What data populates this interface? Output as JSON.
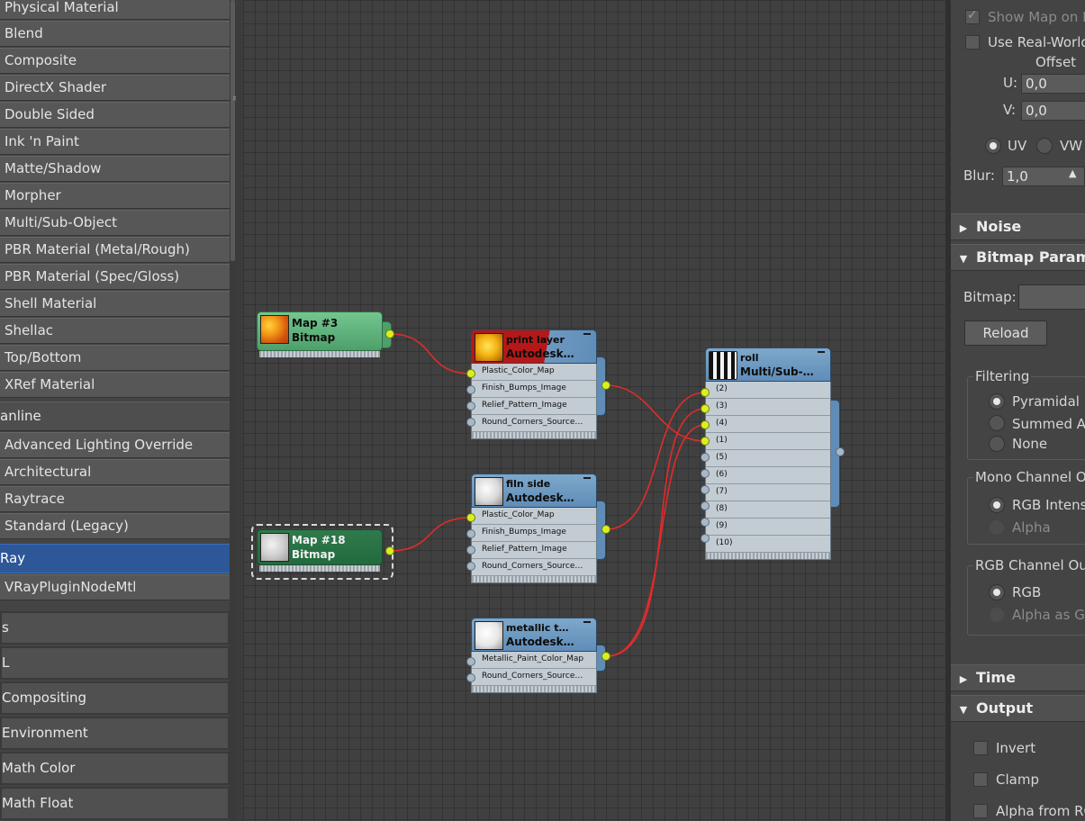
{
  "left_panel": {
    "materials": [
      "Physical Material",
      "Blend",
      "Composite",
      "DirectX Shader",
      "Double Sided",
      "Ink 'n Paint",
      "Matte/Shadow",
      "Morpher",
      "Multi/Sub-Object",
      "PBR Material (Metal/Rough)",
      "PBR Material (Spec/Gloss)",
      "Shell Material",
      "Shellac",
      "Top/Bottom",
      "XRef Material"
    ],
    "scanline_group": "anline",
    "scanline_items": [
      "Advanced Lighting Override",
      "Architectural",
      "Raytrace",
      "Standard (Legacy)"
    ],
    "vray_group": "Ray",
    "vray_items": [
      "VRayPluginNodeMtl"
    ],
    "map_groups": [
      "s",
      "L",
      "Compositing",
      "Environment",
      "Math Color",
      "Math Float"
    ]
  },
  "nodes": {
    "map3": {
      "title": "Map #3",
      "subtitle": "Bitmap"
    },
    "map18": {
      "title": "Map #18",
      "subtitle": "Bitmap"
    },
    "print_layer": {
      "title": "print layer",
      "subtitle": "Autodesk…",
      "slots": [
        "Plastic_Color_Map",
        "Finish_Bumps_Image",
        "Relief_Pattern_Image",
        "Round_Corners_Source…"
      ]
    },
    "film_side": {
      "title": "filn side",
      "subtitle": "Autodesk…",
      "slots": [
        "Plastic_Color_Map",
        "Finish_Bumps_Image",
        "Relief_Pattern_Image",
        "Round_Corners_Source…"
      ]
    },
    "metallic": {
      "title": "metallic  t…",
      "subtitle": "Autodesk…",
      "slots": [
        "Metallic_Paint_Color_Map",
        "Round_Corners_Source…"
      ]
    },
    "roll": {
      "title": "roll",
      "subtitle": "Multi/Sub-…",
      "slots": [
        "(2)",
        "(3)",
        "(4)",
        "(1)",
        "(5)",
        "(6)",
        "(7)",
        "(8)",
        "(9)",
        "(10)"
      ]
    }
  },
  "right_panel": {
    "show_map_label": "Show Map on B",
    "use_real_world_label": "Use Real-World",
    "offset_label": "Offset",
    "u_label": "U:",
    "u_value": "0,0",
    "v_label": "V:",
    "v_value": "0,0",
    "uv_label": "UV",
    "vw_label": "VW",
    "blur_label": "Blur:",
    "blur_value": "1,0",
    "noise_label": "Noise",
    "bitmap_params_label": "Bitmap Parame",
    "bitmap_label": "Bitmap:",
    "reload_label": "Reload",
    "filtering_label": "Filtering",
    "pyramidal_label": "Pyramidal",
    "summed_label": "Summed Ar",
    "none_label": "None",
    "mono_label": "Mono Channel Ou",
    "rgb_intensity_label": "RGB Intensi",
    "alpha_label": "Alpha",
    "rgb_channel_label": "RGB Channel Out",
    "rgb_label": "RGB",
    "alpha_as_gray_label": "Alpha as Gr",
    "time_label": "Time",
    "output_label": "Output",
    "invert_label": "Invert",
    "clamp_label": "Clamp",
    "alpha_from_label": "Alpha from RG"
  }
}
